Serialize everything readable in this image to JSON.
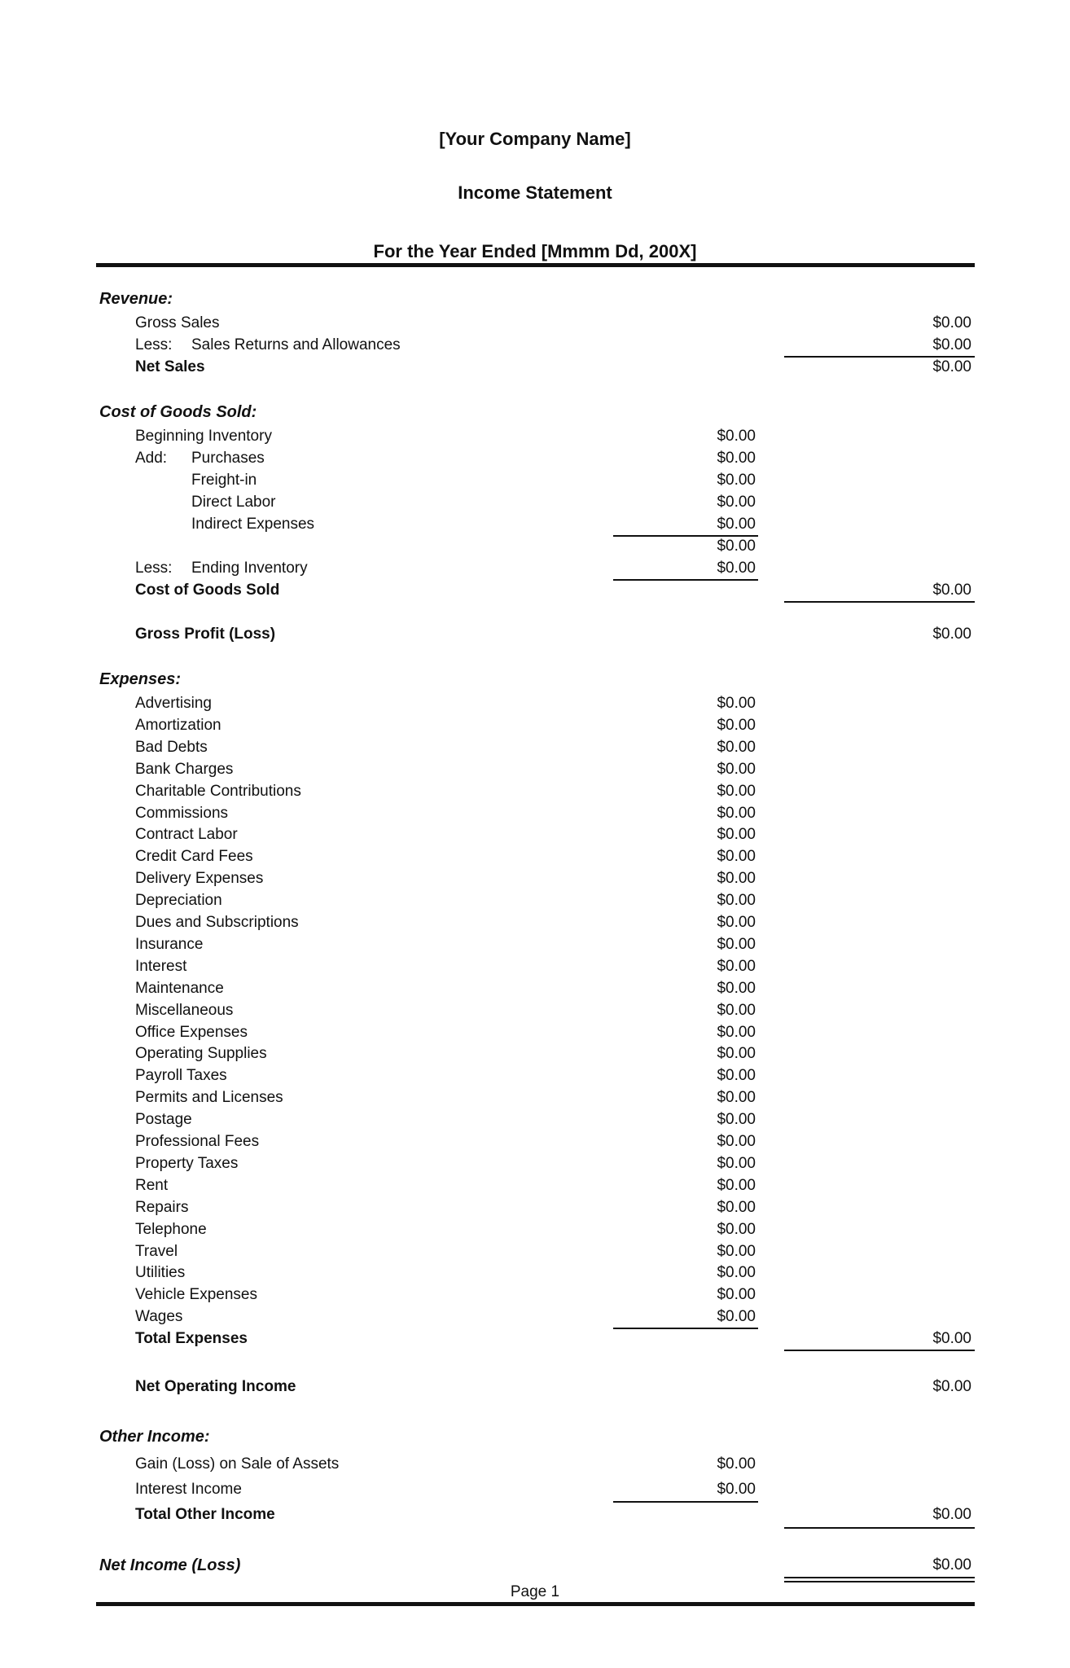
{
  "header": {
    "company": "[Your Company Name]",
    "title": "Income Statement",
    "period": "For the Year Ended [Mmmm Dd, 200X]"
  },
  "revenue": {
    "heading": "Revenue:",
    "gross_sales": {
      "label": "Gross Sales",
      "amount": "$0.00"
    },
    "returns": {
      "prefix": "Less:",
      "label": "Sales Returns and Allowances",
      "amount": "$0.00"
    },
    "net_sales": {
      "label": "Net Sales",
      "amount": "$0.00"
    }
  },
  "cogs": {
    "heading": "Cost of Goods Sold:",
    "beginning": {
      "label": "Beginning Inventory",
      "amount": "$0.00"
    },
    "add_prefix": "Add:",
    "adds": [
      {
        "label": "Purchases",
        "amount": "$0.00"
      },
      {
        "label": "Freight-in",
        "amount": "$0.00"
      },
      {
        "label": "Direct Labor",
        "amount": "$0.00"
      },
      {
        "label": "Indirect Expenses",
        "amount": "$0.00"
      }
    ],
    "subtotal": "$0.00",
    "ending": {
      "prefix": "Less:",
      "label": "Ending Inventory",
      "amount": "$0.00"
    },
    "total": {
      "label": "Cost of Goods Sold",
      "amount": "$0.00"
    },
    "gross_profit": {
      "label": "Gross Profit (Loss)",
      "amount": "$0.00"
    }
  },
  "expenses": {
    "heading": "Expenses:",
    "items": [
      {
        "label": "Advertising",
        "amount": "$0.00"
      },
      {
        "label": "Amortization",
        "amount": "$0.00"
      },
      {
        "label": "Bad Debts",
        "amount": "$0.00"
      },
      {
        "label": "Bank Charges",
        "amount": "$0.00"
      },
      {
        "label": "Charitable Contributions",
        "amount": "$0.00"
      },
      {
        "label": "Commissions",
        "amount": "$0.00"
      },
      {
        "label": "Contract Labor",
        "amount": "$0.00"
      },
      {
        "label": "Credit Card Fees",
        "amount": "$0.00"
      },
      {
        "label": "Delivery Expenses",
        "amount": "$0.00"
      },
      {
        "label": "Depreciation",
        "amount": "$0.00"
      },
      {
        "label": "Dues and Subscriptions",
        "amount": "$0.00"
      },
      {
        "label": "Insurance",
        "amount": "$0.00"
      },
      {
        "label": "Interest",
        "amount": "$0.00"
      },
      {
        "label": "Maintenance",
        "amount": "$0.00"
      },
      {
        "label": "Miscellaneous",
        "amount": "$0.00"
      },
      {
        "label": "Office Expenses",
        "amount": "$0.00"
      },
      {
        "label": "Operating Supplies",
        "amount": "$0.00"
      },
      {
        "label": "Payroll Taxes",
        "amount": "$0.00"
      },
      {
        "label": "Permits and Licenses",
        "amount": "$0.00"
      },
      {
        "label": "Postage",
        "amount": "$0.00"
      },
      {
        "label": "Professional Fees",
        "amount": "$0.00"
      },
      {
        "label": "Property Taxes",
        "amount": "$0.00"
      },
      {
        "label": "Rent",
        "amount": "$0.00"
      },
      {
        "label": "Repairs",
        "amount": "$0.00"
      },
      {
        "label": "Telephone",
        "amount": "$0.00"
      },
      {
        "label": "Travel",
        "amount": "$0.00"
      },
      {
        "label": "Utilities",
        "amount": "$0.00"
      },
      {
        "label": "Vehicle Expenses",
        "amount": "$0.00"
      },
      {
        "label": "Wages",
        "amount": "$0.00"
      }
    ],
    "total": {
      "label": "Total Expenses",
      "amount": "$0.00"
    },
    "net_operating": {
      "label": "Net Operating Income",
      "amount": "$0.00"
    }
  },
  "other_income": {
    "heading": "Other Income:",
    "items": [
      {
        "label": "Gain (Loss) on Sale of Assets",
        "amount": "$0.00"
      },
      {
        "label": "Interest Income",
        "amount": "$0.00"
      }
    ],
    "total": {
      "label": "Total Other Income",
      "amount": "$0.00"
    }
  },
  "net_income": {
    "label": "Net Income (Loss)",
    "amount": "$0.00"
  },
  "footer": {
    "page": "Page 1"
  }
}
